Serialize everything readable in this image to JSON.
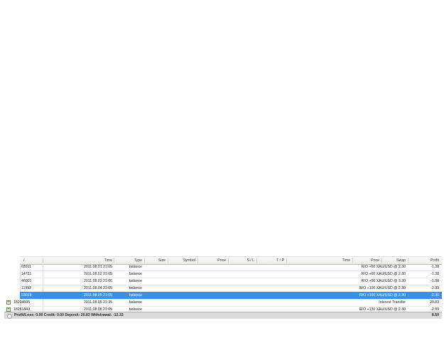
{
  "columns": {
    "ticket": "/",
    "time": "Time",
    "type": "Type",
    "size": "Size",
    "symbol": "Symbol",
    "price": "Price",
    "sl": "S / L",
    "tp": "T / P",
    "close_time": "Time",
    "close_price": "Price",
    "swap": "Swap",
    "profit": "Profit"
  },
  "rows": [
    {
      "ticket": "03911",
      "time": "2011.08.01 21:05",
      "type": "balance",
      "comment": "R/O +60 XAU/USD @ 2.30",
      "profit": "-1.38"
    },
    {
      "ticket": "14721",
      "time": "2011.08.02 21:05",
      "type": "balance",
      "comment": "R/O +60 XAU/USD @ 2.30",
      "profit": "-1.38"
    },
    {
      "ticket": "46001",
      "time": "2011.08.03 21:06",
      "type": "balance",
      "comment": "R/O +60 XAU/USD @ 3.30",
      "profit": "-1.98"
    },
    {
      "ticket": "11992",
      "time": "2011.08.04 21:05",
      "type": "balance",
      "comment": "R/O +100 XAU/USD @ 2.30",
      "profit": "-2.30"
    },
    {
      "ticket": "03019",
      "time": "2011.08.05 21:05",
      "type": "balance",
      "comment": "R/O +100 XAU/USD @ 2.30",
      "profit": "-2.30"
    },
    {
      "ticket": "18204605",
      "time": "2011.08.05 21:35",
      "type": "balance",
      "comment": "Interest Transfer",
      "profit": "20.83"
    },
    {
      "ticket": "18261843",
      "time": "2011.08.08 21:05",
      "type": "balance",
      "comment": "R/O +130 XAU/USD @ 2.30",
      "profit": "-2.99"
    }
  ],
  "selected_row": 4,
  "summary": {
    "label": "Profit/Loss: 0.00  Credit: 0.00  Deposit: 20.83  Withdrawal: -12.33",
    "total": "8.50"
  },
  "colors": {
    "selection": "#3d8ee6",
    "header": "#eceae4",
    "summary": "#dcdcdc"
  }
}
